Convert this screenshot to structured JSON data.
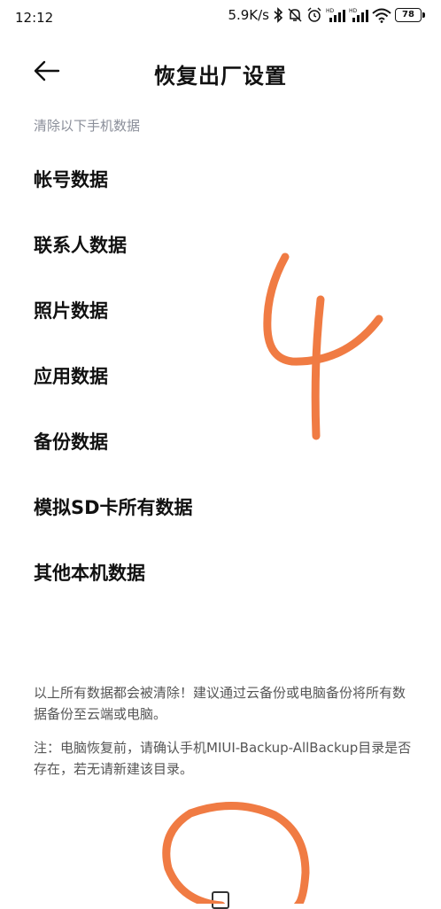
{
  "status_bar": {
    "time": "12:12",
    "speed": "5.9K/s",
    "battery": "78",
    "icons": [
      "bluetooth-icon",
      "mute-icon",
      "alarm-icon",
      "hd-signal-icon",
      "hd-signal-icon",
      "wifi-icon",
      "battery-icon"
    ]
  },
  "header": {
    "back_icon": "arrow-left-icon",
    "title": "恢复出厂设置"
  },
  "section_label": "清除以下手机数据",
  "items": [
    {
      "label": "帐号数据"
    },
    {
      "label": "联系人数据"
    },
    {
      "label": "照片数据"
    },
    {
      "label": "应用数据"
    },
    {
      "label": "备份数据"
    },
    {
      "label": "模拟SD卡所有数据"
    },
    {
      "label": "其他本机数据"
    }
  ],
  "notes": {
    "warning": "以上所有数据都会被清除！建议通过云备份或电脑备份将所有数据备份至云端或电脑。",
    "hint": "注：电脑恢复前，请确认手机MIUI-Backup-AllBackup目录是否存在，若无请新建该目录。"
  },
  "annotation": {
    "handwritten_digit": "4",
    "color": "#f07b43"
  },
  "colors": {
    "background": "#ffffff",
    "text": "#111111",
    "secondary_text": "#8a8e99",
    "note_text": "#555555"
  }
}
